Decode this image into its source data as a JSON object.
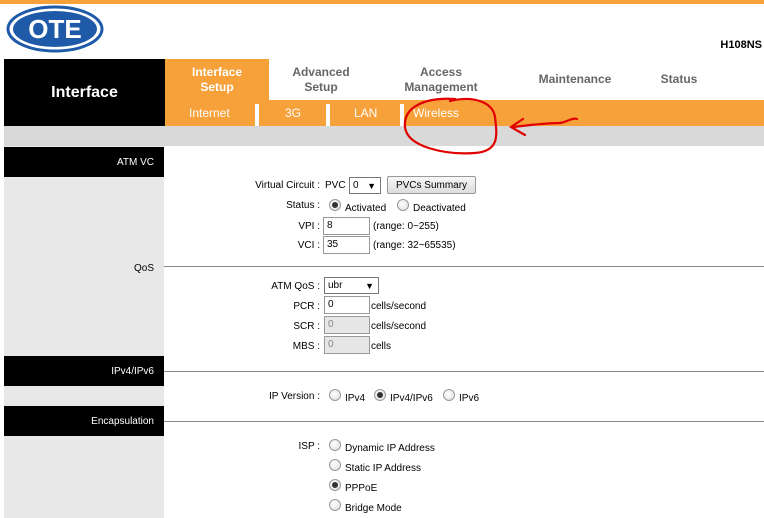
{
  "brand": {
    "logo_text": "OTE",
    "model": "H108NS",
    "accent_color": "#f7a13a"
  },
  "nav": {
    "section_title": "Interface",
    "tabs": [
      {
        "label_line1": "Interface",
        "label_line2": "Setup",
        "active": true
      },
      {
        "label_line1": "Advanced",
        "label_line2": "Setup",
        "active": false
      },
      {
        "label_line1": "Access",
        "label_line2": "Management",
        "active": false
      },
      {
        "label_line1": "Maintenance",
        "label_line2": "",
        "active": false
      },
      {
        "label_line1": "Status",
        "label_line2": "",
        "active": false
      }
    ],
    "subtabs": [
      "Internet",
      "3G",
      "LAN",
      "Wireless"
    ]
  },
  "sections": {
    "atm_vc": "ATM VC",
    "qos": "QoS",
    "ipv4_ipv6": "IPv4/IPv6",
    "encapsulation": "Encapsulation"
  },
  "atm_vc": {
    "virtual_circuit_label": "Virtual Circuit :",
    "pvc_prefix": "PVC",
    "pvc_value": "0",
    "pvcs_summary_button": "PVCs Summary",
    "status_label": "Status :",
    "status_options": [
      "Activated",
      "Deactivated"
    ],
    "status_selected": "Activated",
    "vpi_label": "VPI :",
    "vpi_value": "8",
    "vpi_range": "(range: 0~255)",
    "vci_label": "VCI :",
    "vci_value": "35",
    "vci_range": "(range: 32~65535)"
  },
  "qos": {
    "atm_qos_label": "ATM QoS :",
    "atm_qos_value": "ubr",
    "pcr_label": "PCR :",
    "pcr_value": "0",
    "scr_label": "SCR :",
    "scr_value": "0",
    "mbs_label": "MBS :",
    "mbs_value": "0",
    "unit_cells_per_second": "cells/second",
    "unit_cells": "cells"
  },
  "ip": {
    "version_label": "IP Version :",
    "options": [
      "IPv4",
      "IPv4/IPv6",
      "IPv6"
    ],
    "selected": "IPv4/IPv6"
  },
  "encap": {
    "isp_label": "ISP :",
    "options": [
      "Dynamic IP Address",
      "Static IP Address",
      "PPPoE",
      "Bridge Mode"
    ],
    "selected": "PPPoE"
  },
  "annotation_color": "#e00000"
}
